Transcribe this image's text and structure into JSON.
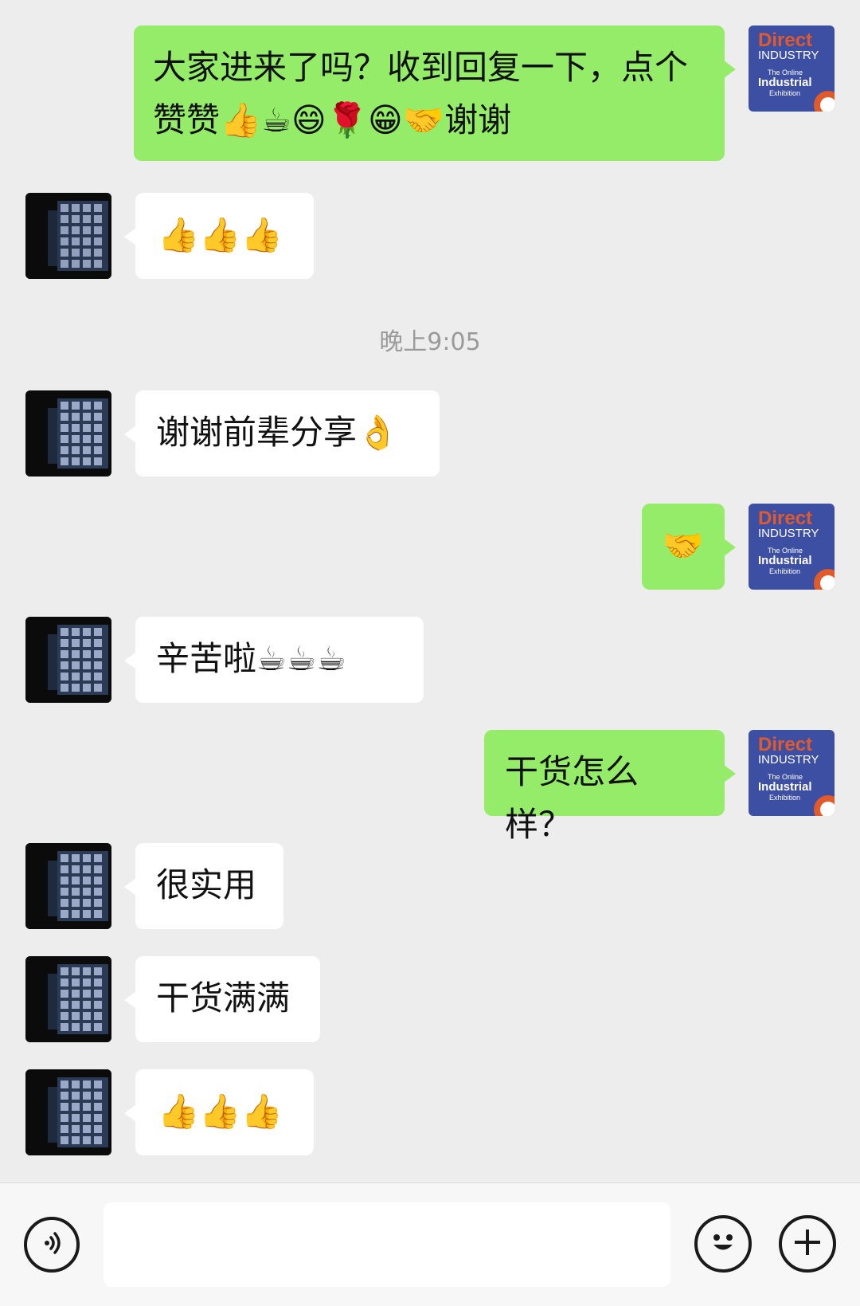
{
  "messages": [
    {
      "side": "right",
      "text": "大家进来了吗？收到回复一下，点个赞赞👍☕😄🌹😁🤝谢谢"
    },
    {
      "side": "left",
      "text": "👍👍👍"
    },
    {
      "side": "time",
      "text": "晚上9:05"
    },
    {
      "side": "left",
      "text": "谢谢前辈分享👌"
    },
    {
      "side": "right",
      "text": "🤝"
    },
    {
      "side": "left",
      "text": "辛苦啦☕☕☕"
    },
    {
      "side": "right",
      "text": "干货怎么样？"
    },
    {
      "side": "left",
      "text": "很实用"
    },
    {
      "side": "left",
      "text": "干货满满"
    },
    {
      "side": "left",
      "text": "👍👍👍"
    }
  ],
  "self_avatar": {
    "line1": "Direct",
    "line2": "INDUSTRY",
    "line3": "The Online",
    "line4": "Industrial",
    "line5": "Exhibition",
    "colors": {
      "bg": "#3d4fa3",
      "accent": "#e05a2b"
    }
  },
  "colors": {
    "outgoing": "#95ec69",
    "incoming": "#ffffff",
    "background": "#ededed"
  },
  "input_bar": {
    "voice_icon": "voice-icon",
    "emoji_icon": "emoji-icon",
    "plus_icon": "plus-icon",
    "placeholder": ""
  }
}
